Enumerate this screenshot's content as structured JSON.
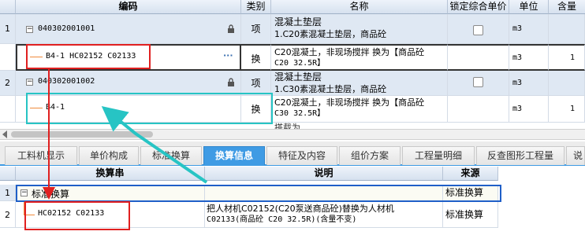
{
  "top_grid": {
    "headers": {
      "code": "编码",
      "type": "类别",
      "name": "名称",
      "lock_price": "锁定综合单价",
      "unit": "单位",
      "qty": "含量"
    },
    "rows": [
      {
        "num": "1",
        "code": "040302001001",
        "type": "项",
        "name1": "混凝土垫层",
        "name2": "1.C20素混凝土垫层，商品砼",
        "unit": "m3",
        "qty": ""
      },
      {
        "num": "",
        "code": "B4-1 HC02152 C02133",
        "type": "换",
        "name1": "C20混凝土，非现场搅拌  换为【商品砼",
        "name2": "C20 32.5R】",
        "unit": "m3",
        "qty": "1",
        "ellipsis": "···"
      },
      {
        "num": "2",
        "code": "040302001002",
        "type": "项",
        "name1": "混凝土垫层",
        "name2": "1.C30素混凝土垫层，商品砼",
        "unit": "m3",
        "qty": ""
      },
      {
        "num": "",
        "code": "B4-1",
        "type": "换",
        "name1": "C20混凝土，非现场搅拌  换为【商品砼",
        "name2": "C30 32.5R】",
        "unit": "m3",
        "qty": "1"
      },
      {
        "num": "",
        "code": "",
        "type": "",
        "name1": "搭载为",
        "name2": "",
        "unit": "",
        "qty": ""
      }
    ]
  },
  "tabs": [
    "工料机显示",
    "单价构成",
    "标准换算",
    "换算信息",
    "特征及内容",
    "组价方案",
    "工程量明细",
    "反查图形工程量",
    "说"
  ],
  "active_tab": "换算信息",
  "bottom_grid": {
    "headers": {
      "conv": "换算串",
      "desc": "说明",
      "source": "来源"
    },
    "rows": [
      {
        "num": "1",
        "conv": "标准换算",
        "desc": "",
        "source": "标准换算"
      },
      {
        "num": "2",
        "conv": "HC02152 C02133",
        "desc1": "把人材机C02152(C20泵送商品砼)替换为人材机",
        "desc2": "C02133(商品砼 C20 32.5R)(含量不变)",
        "source": "标准换算"
      }
    ]
  },
  "colors": {
    "accent": "#3f9be4",
    "red_box": "#e02020",
    "cyan_box": "#27c4c4",
    "orange_line": "#f08a3c"
  }
}
